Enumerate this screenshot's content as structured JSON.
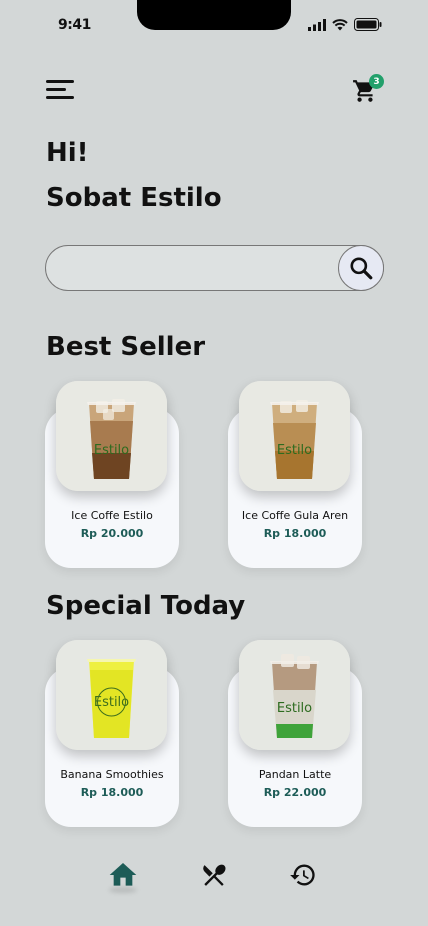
{
  "status": {
    "time": "9:41"
  },
  "header": {
    "cart_count": "3"
  },
  "greeting": {
    "hi": "Hi!",
    "name": "Sobat Estilo"
  },
  "search": {
    "placeholder": "",
    "value": ""
  },
  "best_seller": {
    "title": "Best Seller",
    "items": [
      {
        "name": "Ice Coffe Estilo",
        "price": "Rp 20.000",
        "brand": "Estilo"
      },
      {
        "name": "Ice Coffe Gula Aren",
        "price": "Rp 18.000",
        "brand": "Estilo"
      }
    ]
  },
  "special_today": {
    "title": "Special Today",
    "items": [
      {
        "name": "Banana Smoothies",
        "price": "Rp 18.000",
        "brand": "Estilo"
      },
      {
        "name": "Pandan Latte",
        "price": "Rp 22.000",
        "brand": "Estilo"
      }
    ]
  },
  "nav": {
    "active": "home",
    "items": [
      "home-icon",
      "menu-icon",
      "history-icon"
    ]
  },
  "colors": {
    "accent": "#1d5c57",
    "badge": "#22a06b",
    "background": "#d3d7d7"
  }
}
